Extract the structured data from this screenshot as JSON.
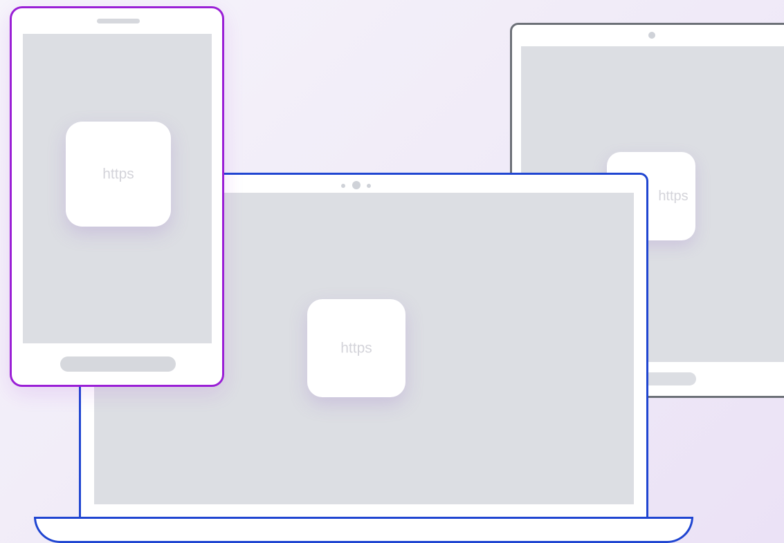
{
  "devices": {
    "phone": {
      "label": "https",
      "border_color": "#9a1fd6"
    },
    "laptop": {
      "label": "https",
      "border_color": "#1f45d1"
    },
    "tablet": {
      "label": "https",
      "border_color": "#6c7077"
    }
  },
  "colors": {
    "screen": "#dcdee3",
    "tile": "#ffffff",
    "tile_text": "#d4d4da",
    "background": "#f1ecf8"
  }
}
